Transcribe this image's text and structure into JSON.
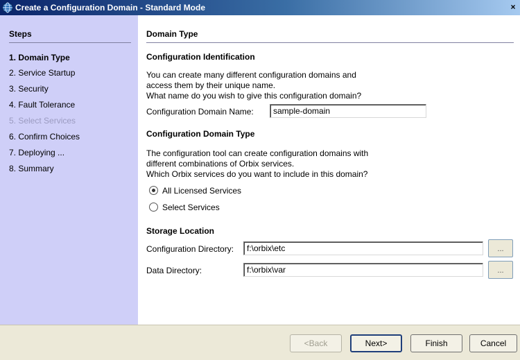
{
  "window": {
    "title": "Create a Configuration Domain - Standard Mode",
    "close_glyph": "×"
  },
  "sidebar": {
    "title": "Steps",
    "steps": [
      {
        "label": "1. Domain Type",
        "state": "active"
      },
      {
        "label": "2. Service Startup",
        "state": "normal"
      },
      {
        "label": "3. Security",
        "state": "normal"
      },
      {
        "label": "4. Fault Tolerance",
        "state": "normal"
      },
      {
        "label": "5. Select Services",
        "state": "disabled"
      },
      {
        "label": "6. Confirm Choices",
        "state": "normal"
      },
      {
        "label": "7. Deploying ...",
        "state": "normal"
      },
      {
        "label": "8. Summary",
        "state": "normal"
      }
    ]
  },
  "main": {
    "page_title": "Domain Type",
    "identification": {
      "heading": "Configuration Identification",
      "desc_line1": "You can create many different configuration domains and",
      "desc_line2": "access them by their unique name.",
      "desc_line3": "What name do you wish to give this configuration domain?",
      "name_label": "Configuration Domain Name:",
      "name_value": "sample-domain"
    },
    "domain_type": {
      "heading": "Configuration Domain Type",
      "desc_line1": "The configuration tool can create configuration domains with",
      "desc_line2": "different combinations of Orbix services.",
      "desc_line3": "Which Orbix services do you want to include in this domain?",
      "option_all": "All Licensed Services",
      "option_select": "Select Services",
      "selected": "All Licensed Services"
    },
    "storage": {
      "heading": "Storage Location",
      "config_dir_label": "Configuration Directory:",
      "config_dir_value": "f:\\orbix\\etc",
      "data_dir_label": "Data Directory:",
      "data_dir_value": "f:\\orbix\\var",
      "browse_label": "..."
    }
  },
  "footer": {
    "back_label": "<Back",
    "next_label": "Next>",
    "finish_label": "Finish",
    "cancel_label": "Cancel"
  },
  "colors": {
    "sidebar_bg": "#cfcff8",
    "titlebar_start": "#0a246a",
    "titlebar_end": "#a6caf0",
    "footer_bg": "#ece9d8"
  }
}
